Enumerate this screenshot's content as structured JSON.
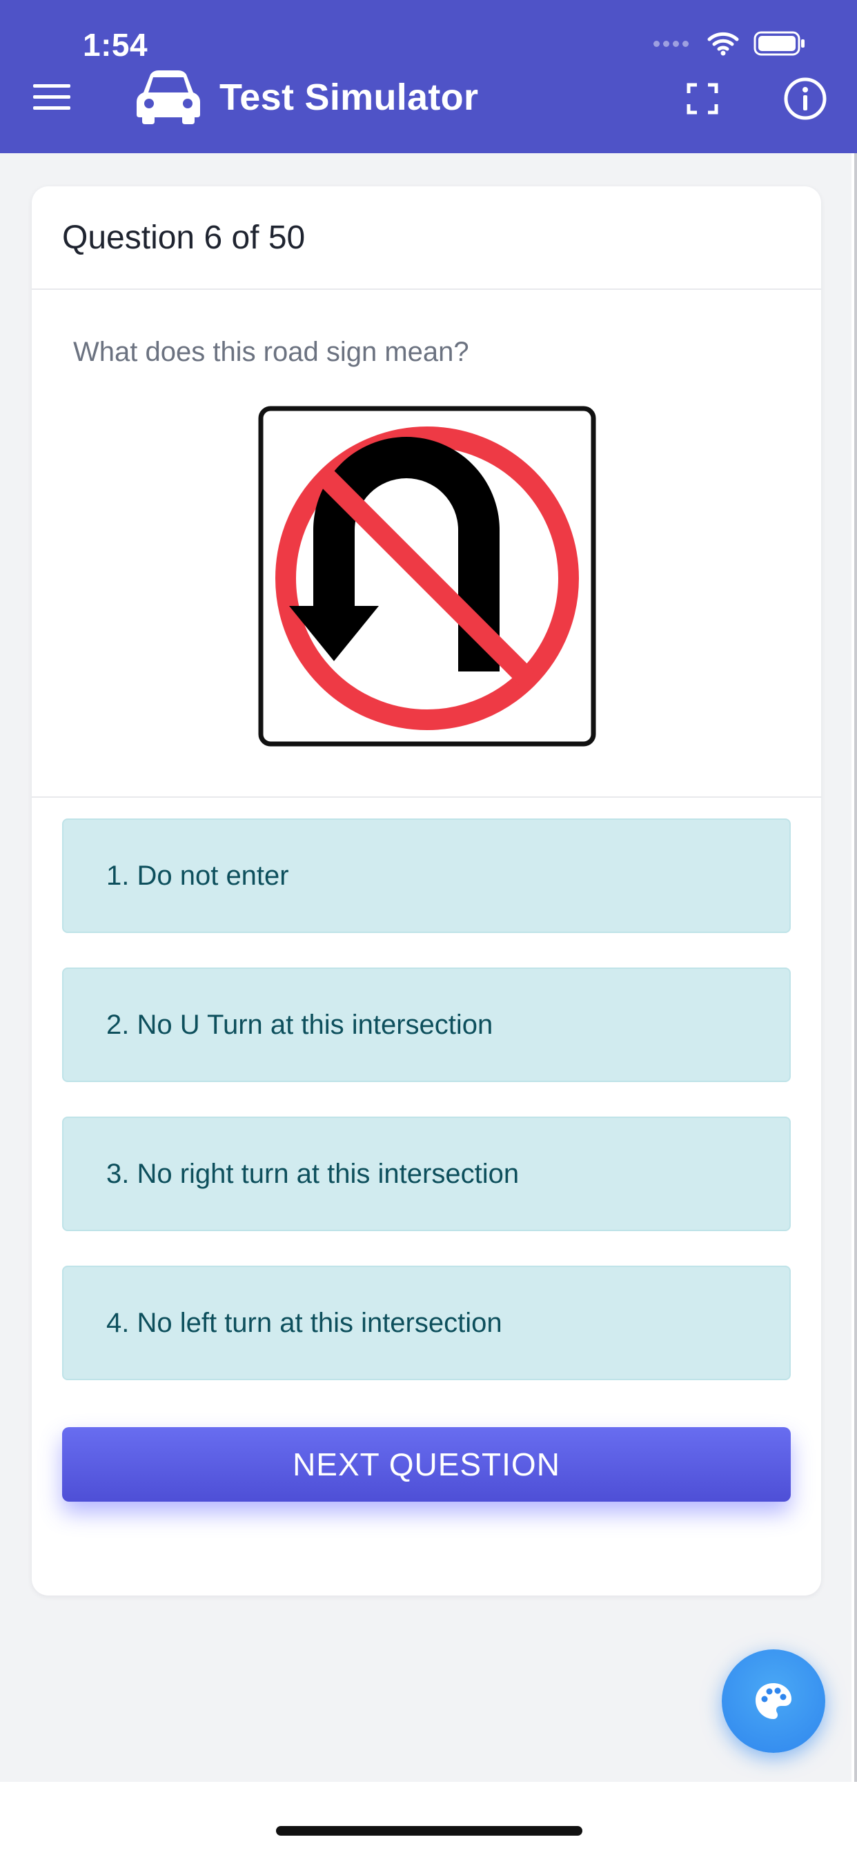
{
  "status_bar": {
    "time": "1:54"
  },
  "app_bar": {
    "title": "Test Simulator",
    "menu_icon": "hamburger-menu-icon",
    "logo_icon": "car-icon",
    "fullscreen_icon": "fullscreen-icon",
    "info_icon": "info-icon"
  },
  "card": {
    "counter": "Question 6 of 50",
    "question": "What does this road sign mean?",
    "sign_image": "no-u-turn-sign",
    "answers": [
      {
        "label": "1. Do not enter"
      },
      {
        "label": "2. No U Turn at this intersection"
      },
      {
        "label": "3. No right turn at this intersection"
      },
      {
        "label": "4. No left turn at this intersection"
      }
    ],
    "next_button": "NEXT QUESTION"
  },
  "fab": {
    "icon": "palette-icon"
  },
  "colors": {
    "header": "#4f53c7",
    "answer_bg": "#d1ebef",
    "answer_text": "#0d4f5c",
    "button": "#5a5ee6",
    "fab": "#2f86ee"
  }
}
